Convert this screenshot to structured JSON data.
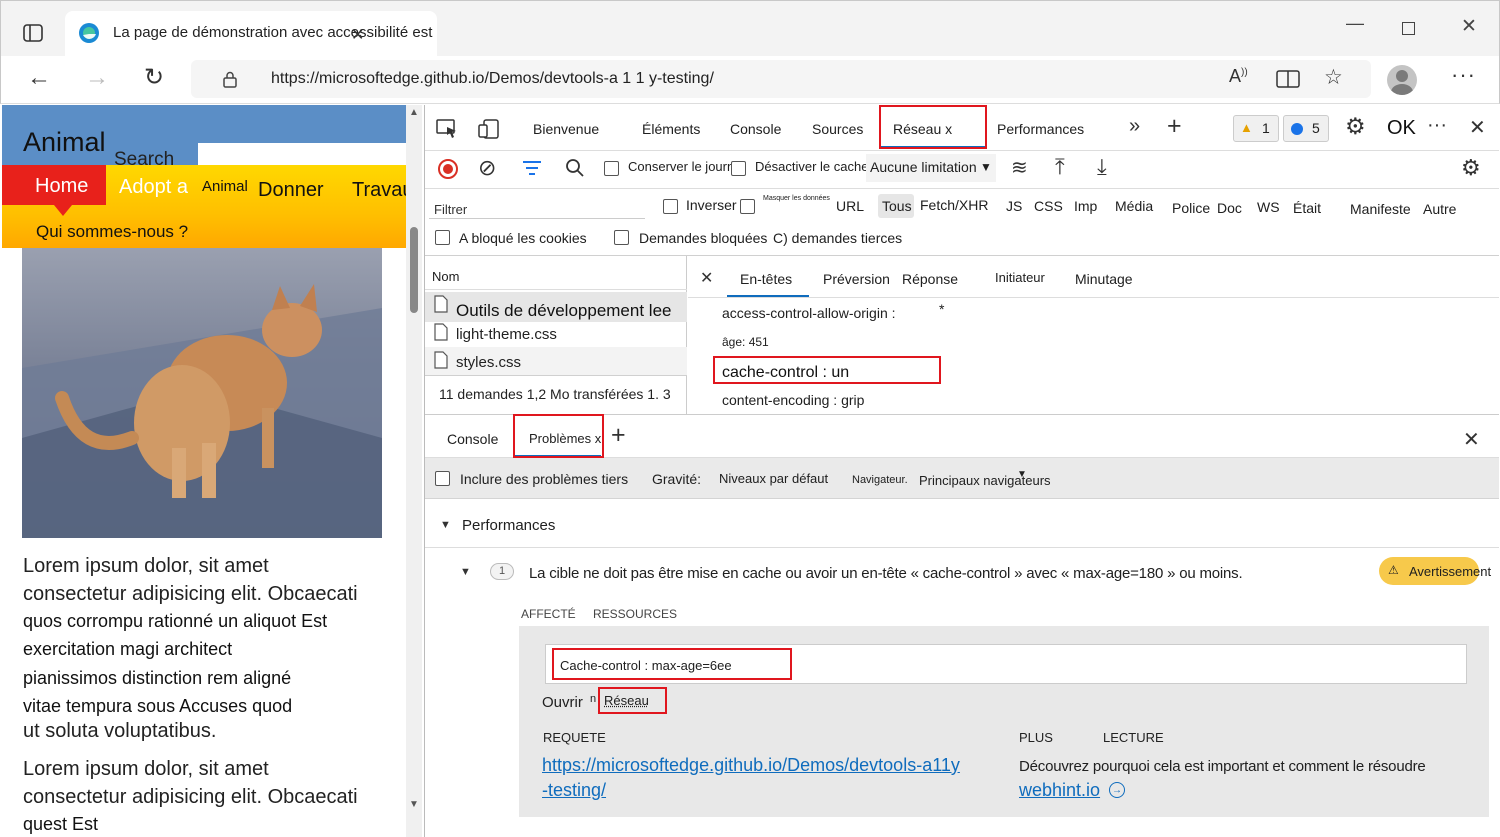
{
  "browser": {
    "tab_title": "La page de démonstration avec accessibilité est",
    "url": "https://microsoftedge.github.io/Demos/devtools-a 1 1 y-testing/"
  },
  "page": {
    "logo": "Animal",
    "search_label": "Search",
    "nav": [
      "Home",
      "Adopt a",
      "Animal",
      "Donner",
      "Travaux"
    ],
    "nav_sub": "Qui sommes-nous ?",
    "para1": [
      "Lorem ipsum dolor, sit amet",
      "consectetur adipisicing elit. Obcaecati",
      "quos corrompu rationné un aliquot Est",
      "exercitation magi architect",
      "pianissimos distinction rem aligné",
      "vitae tempura sous Accuses quod",
      "ut soluta voluptatibus."
    ],
    "para2": [
      "Lorem ipsum dolor, sit amet",
      "consectetur adipisicing elit. Obcaecati",
      "quest Est"
    ]
  },
  "devtools": {
    "tabs": [
      "Bienvenue",
      "Éléments",
      "Console",
      "Sources",
      "Réseau x",
      "Performances"
    ],
    "warn_count": "1",
    "msg_count": "5",
    "ok_label": "OK",
    "network": {
      "preserve_log": "Conserver le journal",
      "disable_cache": "Désactiver le cache",
      "throttle": "Aucune limitation",
      "filter_label": "Filtrer",
      "invert": "Inverser",
      "hide_data": "Masquer les données",
      "url_label": "URL",
      "types": [
        "Tous",
        "Fetch/XHR",
        "JS",
        "CSS",
        "Imp",
        "Média",
        "Police",
        "Doc",
        "WS",
        "Était",
        "Manifeste",
        "Autre"
      ],
      "blocked_cookies": "A bloqué les cookies",
      "blocked_requests": "Demandes bloquées",
      "third_party": "C) demandes tierces",
      "name_header": "Nom",
      "files": [
        "Outils de développement lee",
        "light-theme.css",
        "styles.css"
      ],
      "status_bar": "11 demandes 1,2 Mo transférées 1. 3",
      "detail_tabs": [
        "En-têtes",
        "Préversion",
        "Réponse",
        "Initiateur",
        "Minutage"
      ],
      "headers": [
        {
          "name": "access-control-allow-origin :",
          "value": "*"
        },
        {
          "name": "âge: 451",
          "value": ""
        },
        {
          "name": "cache-control : un",
          "value": ""
        },
        {
          "name": "content-encoding : grip",
          "value": ""
        }
      ]
    },
    "drawer": {
      "tabs": [
        "Console",
        "Problèmes x"
      ],
      "include_third": "Inclure des problèmes tiers",
      "severity_label": "Gravité:",
      "severity_value": "Niveaux par défaut",
      "browser_label": "Navigateur.",
      "browser_value": "Principaux navigateurs",
      "category": "Performances",
      "issue_count": "1",
      "issue_text": "La cible ne doit pas être mise en cache ou avoir un en-tête « cache-control » avec « max-age=180 » ou moins.",
      "warning_badge": "Avertissement",
      "affected": "AFFECTÉ",
      "resources": "RESSOURCES",
      "resource_value": "Cache-control : max-age=6ee",
      "open_in": "Ouvrir",
      "open_in_small": "n",
      "network_link": "Réseau",
      "request_label": "REQUETE",
      "request_url_1": "https://microsoftedge.github.io/Demos/devtools-a11y",
      "request_url_2": "-testing/",
      "more_label": "PLUS",
      "read_label": "LECTURE",
      "learn_text": "Découvrez pourquoi cela est important et comment le résoudre",
      "webhint": "webhint.io"
    }
  },
  "colors": {
    "accent": "#0f6cbd",
    "red_box": "#e0161e",
    "warning": "#f7c94b",
    "nav_red": "#e8211b"
  }
}
